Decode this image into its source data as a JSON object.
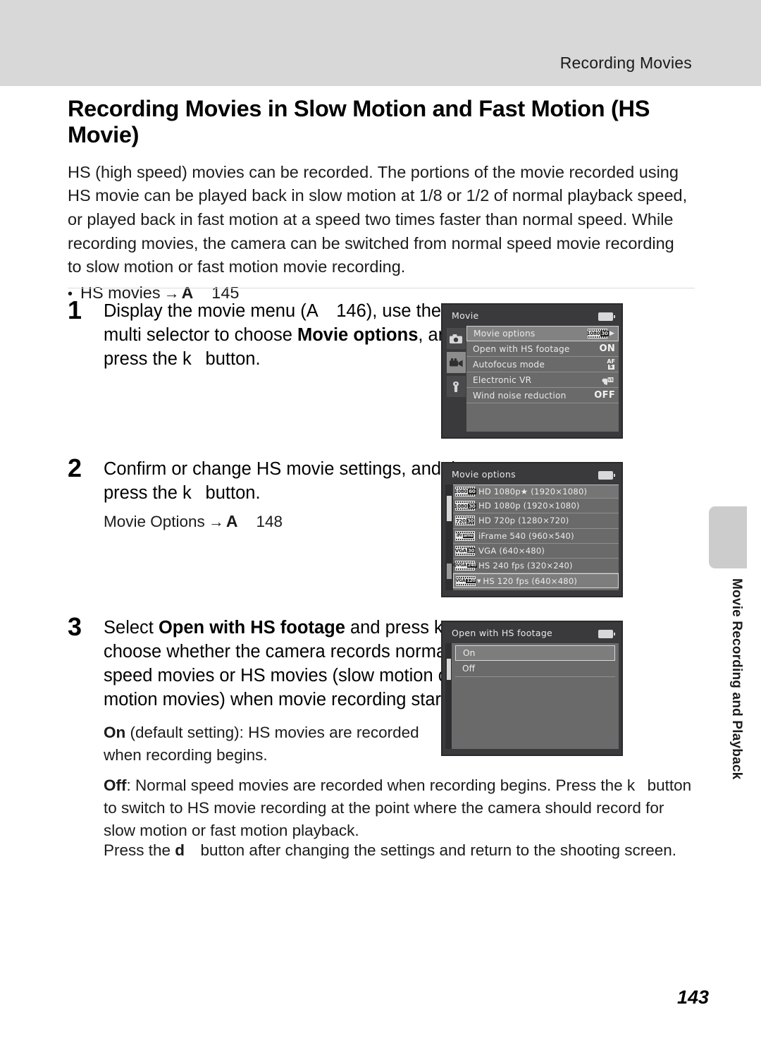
{
  "header": {
    "running_title": "Recording Movies"
  },
  "chapter": {
    "title": "Recording Movies in Slow Motion and Fast Motion (HS Movie)",
    "intro": "HS (high speed) movies can be recorded. The portions of the movie recorded using HS movie can be played back in slow motion at 1/8 or 1/2 of normal playback speed, or played back in fast motion at a speed two times faster than normal speed. While recording movies, the camera can be switched from normal speed movie recording to slow motion or fast motion movie recording.",
    "bullet": {
      "text": "HS movies",
      "arrow": "→",
      "glyph": "A",
      "page_ref": "145"
    }
  },
  "steps": [
    {
      "number": "1",
      "text_pre": "Display the movie menu (A  146), use the rotary multi selector to choose ",
      "bold_1": "Movie options",
      "text_post": ", and then press the k  button."
    },
    {
      "number": "2",
      "text": "Confirm or change HS movie settings, and then press the k  button.",
      "sub_note": {
        "label": "Movie Options",
        "arrow": "→",
        "glyph": "A",
        "page_ref": "148"
      }
    },
    {
      "number": "3",
      "text_pre": "Select ",
      "bold_1": "Open with HS footage",
      "text_post": " and press k  to choose whether the camera records normal speed movies or HS movies (slow motion or fast motion movies) when movie recording starts."
    }
  ],
  "notes": {
    "on_label": "On",
    "on_text": " (default setting): HS movies are recorded when recording begins.",
    "off_label": "Off",
    "off_text": ": Normal speed movies are recorded when recording begins. Press the k  button to switch to HS movie recording at the point where the camera should record for slow motion or fast motion playback.",
    "press_pre": "Press the ",
    "press_glyph": "d",
    "press_post": "  button after changing the settings and return to the shooting screen."
  },
  "screens": {
    "movie_menu": {
      "title": "Movie",
      "tabs": [
        "camera-icon",
        "movie-camera-icon",
        "wrench-icon"
      ],
      "selected_tab": 1,
      "rows": [
        {
          "label": "Movie options",
          "value": "icon-1080-30",
          "selected": true
        },
        {
          "label": "Open with HS footage",
          "value": "ON",
          "selected": false
        },
        {
          "label": "Autofocus mode",
          "value": "AF-S",
          "selected": false
        },
        {
          "label": "Electronic VR",
          "value": "vr-icon",
          "selected": false
        },
        {
          "label": "Wind noise reduction",
          "value": "OFF",
          "selected": false
        }
      ]
    },
    "movie_options": {
      "title": "Movie options",
      "rows": [
        {
          "icon_a": "1080",
          "icon_b": "60",
          "label": "HD 1080p★ (1920×1080)",
          "state": "first"
        },
        {
          "icon_a": "1080",
          "icon_b": "30",
          "label": "HD 1080p (1920×1080)",
          "state": ""
        },
        {
          "icon_a": "720",
          "icon_b": "30",
          "label": "HD 720p (1280×720)",
          "state": ""
        },
        {
          "icon_a": "iFr",
          "icon_b": "ame",
          "label": "iFrame 540 (960×540)",
          "state": ""
        },
        {
          "icon_a": "VGA",
          "icon_b": "30",
          "label": "VGA (640×480)",
          "state": ""
        },
        {
          "icon_a": "QVGA",
          "icon_b": "240",
          "label": "HS 240 fps (320×240)",
          "state": ""
        },
        {
          "icon_a": "VGA",
          "icon_b": "120",
          "label": "HS 120 fps (640×480)",
          "state": "sel"
        }
      ]
    },
    "open_with_hs": {
      "title": "Open with HS footage",
      "rows": [
        {
          "label": "On",
          "selected": true
        },
        {
          "label": "Off",
          "selected": false
        }
      ]
    }
  },
  "side_tab": {
    "label": "Movie Recording and Playback"
  },
  "footer": {
    "page_number": "143"
  },
  "colors": {
    "header_band": "#d8d8d8",
    "lcd_background": "#6a6a6a",
    "lcd_chrome": "#3a3a3c",
    "side_tab": "#cccccc"
  }
}
